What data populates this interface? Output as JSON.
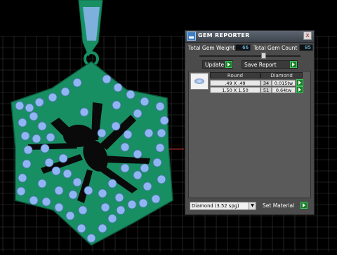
{
  "panel": {
    "title": "GEM REPORTER",
    "close_label": "x",
    "total_gem_weight_label": "Total Gem Weight",
    "total_gem_weight_value": "66",
    "total_gem_count_label": "Total Gem Count",
    "total_gem_count_value": "85",
    "update_label": "Update",
    "save_report_label": "Save Report",
    "table": {
      "headers": [
        "Round",
        "Diamond"
      ],
      "rows": [
        {
          "size": ".49 X .49",
          "count": "34",
          "weight": "0.015tw"
        },
        {
          "size": "1.50 X 1.50",
          "count": "51",
          "weight": "0.64tw"
        }
      ]
    },
    "material_select_value": "Diamond    (3.52 spg)",
    "set_material_label": "Set Material"
  },
  "colors": {
    "pendant": "#178f63",
    "gem": "#8fb6f2",
    "grid": "#4a4a4a",
    "panel": "#4b4b4b"
  }
}
